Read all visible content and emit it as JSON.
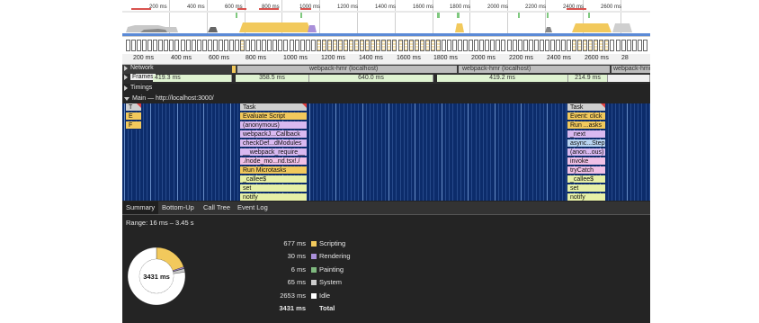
{
  "overview": {
    "ticks": [
      "200 ms",
      "400 ms",
      "600 ms",
      "800 ms",
      "1000 ms",
      "1200 ms",
      "1400 ms",
      "1600 ms",
      "1800 ms",
      "2000 ms",
      "2200 ms",
      "2400 ms",
      "2600 ms"
    ]
  },
  "ruler": {
    "ticks": [
      "200 ms",
      "400 ms",
      "600 ms",
      "800 ms",
      "1000 ms",
      "1200 ms",
      "1400 ms",
      "1600 ms",
      "1800 ms",
      "2000 ms",
      "2200 ms",
      "2400 ms",
      "2600 ms",
      "28"
    ]
  },
  "tracks": {
    "network": {
      "label": "Network",
      "bars": [
        "webpack-hmr (localhost)",
        "webpack-hmr (localhost)",
        "webpack-hmr"
      ]
    },
    "frames": {
      "label": "Frames",
      "values": [
        "419.3 ms",
        "358.5 ms",
        "640.0 ms",
        "419.2 ms",
        "214.9 ms"
      ]
    },
    "timings": {
      "label": "Timings"
    },
    "main": {
      "label": "Main — http://localhost:3000/"
    }
  },
  "flame": {
    "col1": [
      "T",
      "E",
      "F"
    ],
    "col2": [
      "Task",
      "Evaluate Script",
      "(anonymous)",
      "webpackJ...Callback",
      "checkDef...dModules",
      "__webpack_require__",
      "./node_mo...nd.tsx!./",
      "Run Microtasks",
      "_callee$",
      "set",
      "notify"
    ],
    "col3": [
      "Task",
      "Event: click",
      "Run ...asks",
      "_next",
      "async...Step",
      "(anon...ous)",
      "invoke",
      "tryCatch",
      "_callee$",
      "set",
      "notify"
    ]
  },
  "tabs": [
    "Summary",
    "Bottom-Up",
    "Call Tree",
    "Event Log"
  ],
  "summary": {
    "range": "Range: 16 ms – 3.45 s",
    "donut_label": "3431 ms",
    "rows": [
      {
        "value": "677 ms",
        "name": "Scripting",
        "color": "#f2c95c"
      },
      {
        "value": "30 ms",
        "name": "Rendering",
        "color": "#a98fd9"
      },
      {
        "value": "6 ms",
        "name": "Painting",
        "color": "#7fb97f"
      },
      {
        "value": "65 ms",
        "name": "System",
        "color": "#cccccc"
      },
      {
        "value": "2653 ms",
        "name": "Idle",
        "color": "#ffffff"
      }
    ],
    "total": {
      "value": "3431 ms",
      "name": "Total"
    }
  },
  "colors": {
    "scripting": "#f2c95c",
    "rendering": "#a98fd9",
    "painting": "#7fb97f",
    "system": "#cccccc",
    "idle": "#ffffff",
    "task": "#cfcfcf",
    "main_bg": "#0c2c6b",
    "frame": "#dff3d1"
  }
}
